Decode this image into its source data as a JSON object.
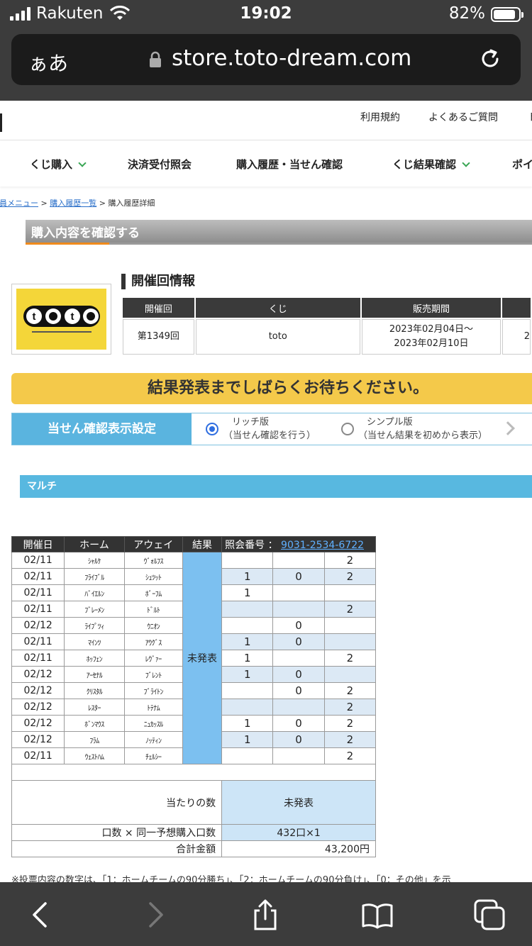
{
  "status_bar": {
    "carrier": "Rakuten",
    "time": "19:02",
    "battery": "82%",
    "battery_level": 0.82
  },
  "browser": {
    "reader_label": "ぁあ",
    "url": "store.toto-dream.com"
  },
  "util_nav": [
    "利用規約",
    "よくあるご質問",
    "ト"
  ],
  "main_nav": [
    "くじ購入",
    "決済受付照会",
    "購入履歴・当せん確認",
    "くじ結果確認",
    "ポイ"
  ],
  "breadcrumb": {
    "home": "会員メニュー",
    "list": "購入履歴一覧",
    "current": "購入履歴詳細",
    "sep": ">"
  },
  "section_title": "購入内容を確認する",
  "logo_text": "toto",
  "kaisai": {
    "title": "開催回情報",
    "headers": [
      "開催回",
      "くじ",
      "販売期間",
      ""
    ],
    "round": "第1349回",
    "lottery": "toto",
    "period_start": "2023年02月04日〜",
    "period_end": "2023年02月10日",
    "extra": "2"
  },
  "notice": "結果発表までしばらくお待ちください。",
  "display_setting": {
    "label": "当せん確認表示設定",
    "rich": {
      "title": "リッチ版",
      "sub": "（当せん確認を行う）"
    },
    "simple": {
      "title": "シンプル版",
      "sub": "（当せん結果を初めから表示）"
    }
  },
  "multi_label": "マルチ",
  "table": {
    "headers": {
      "date": "開催日",
      "home": "ホーム",
      "away": "アウェイ",
      "result": "結果",
      "inquiry_label": "照会番号 ：",
      "inquiry_number": "9031-2534-6722"
    },
    "result_pending": "未発表",
    "rows": [
      {
        "date": "02/11",
        "home": "ｼｬﾙｹ",
        "away": "ｳﾞｫﾙﾌｽ",
        "p1": "",
        "p0": "",
        "p2": "2"
      },
      {
        "date": "02/11",
        "home": "ﾌﾗｲﾌﾞﾙ",
        "away": "ｼｭﾂｯﾄ",
        "p1": "1",
        "p0": "0",
        "p2": "2"
      },
      {
        "date": "02/11",
        "home": "ﾊﾞｲｴﾙﾝ",
        "away": "ﾎﾞｰﾌﾑ",
        "p1": "1",
        "p0": "",
        "p2": ""
      },
      {
        "date": "02/11",
        "home": "ﾌﾞﾚｰﾒﾝ",
        "away": "ﾄﾞﾙﾄ",
        "p1": "",
        "p0": "",
        "p2": "2"
      },
      {
        "date": "02/12",
        "home": "ﾗｲﾌﾟﾂｨ",
        "away": "ｳﾆｵﾝ",
        "p1": "",
        "p0": "0",
        "p2": ""
      },
      {
        "date": "02/11",
        "home": "ﾏｲﾝﾂ",
        "away": "ｱｳｸﾞｽ",
        "p1": "1",
        "p0": "0",
        "p2": ""
      },
      {
        "date": "02/11",
        "home": "ﾎｯﾌｪﾝ",
        "away": "ﾚｳﾞｧｰ",
        "p1": "1",
        "p0": "",
        "p2": "2"
      },
      {
        "date": "02/12",
        "home": "ｱｰｾﾅﾙ",
        "away": "ﾌﾞﾚﾝﾄ",
        "p1": "1",
        "p0": "0",
        "p2": ""
      },
      {
        "date": "02/12",
        "home": "ｸﾘｽﾀﾙ",
        "away": "ﾌﾞﾗｲﾄﾝ",
        "p1": "",
        "p0": "0",
        "p2": "2"
      },
      {
        "date": "02/12",
        "home": "ﾚｽﾀｰ",
        "away": "ﾄﾃﾅﾑ",
        "p1": "",
        "p0": "",
        "p2": "2"
      },
      {
        "date": "02/12",
        "home": "ﾎﾞﾝﾏｳｽ",
        "away": "ﾆｭｶｯｽﾙ",
        "p1": "1",
        "p0": "0",
        "p2": "2"
      },
      {
        "date": "02/12",
        "home": "ﾌﾗﾑ",
        "away": "ﾉｯﾃｨﾝ",
        "p1": "1",
        "p0": "0",
        "p2": "2"
      },
      {
        "date": "02/11",
        "home": "ｳｪｽﾄﾊﾑ",
        "away": "ﾁｪﾙｼｰ",
        "p1": "",
        "p0": "",
        "p2": "2"
      }
    ],
    "hits_label": "当たりの数",
    "hits_value": "未発表",
    "units_label": "口数 × 同一予想購入口数",
    "units_value": "432口×1",
    "total_label": "合計金額",
    "total_value": "43,200円"
  },
  "footnote": "※投票内容の数字は、「1：ホームチームの90分勝ち」、「2：ホームチームの90分負け」、「0：その他」を示",
  "icons": [
    "wifi-icon",
    "lock-icon",
    "reload-icon",
    "back-icon",
    "forward-icon",
    "share-icon",
    "bookmarks-icon",
    "tabs-icon"
  ]
}
